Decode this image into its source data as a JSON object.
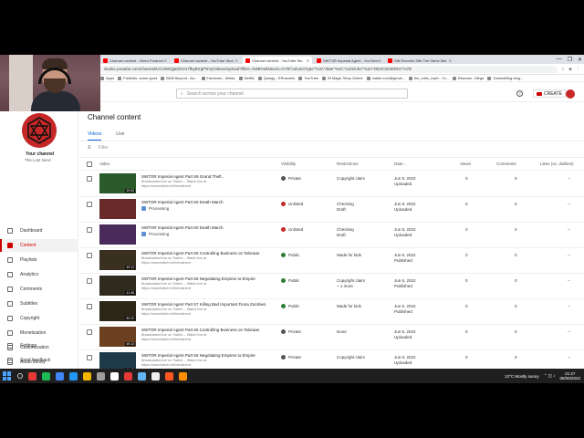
{
  "browser": {
    "tabs": [
      {
        "label": "Channel content - Video Producti",
        "color": "#ff0000"
      },
      {
        "label": "Channel content - YouTube Stud",
        "color": "#ff0000"
      },
      {
        "label": "Channel content - YouTube Stu",
        "color": "#ff0000",
        "active": true
      },
      {
        "label": "SWTOR Imperial Agent - YouTube",
        "color": "#ff0000"
      },
      {
        "label": "Still Recruits Sith The Stone Mol",
        "color": "#ff0000"
      }
    ],
    "url": "studio.youtube.com/channel/UCHiWQpDbOrs7fbyBrrgFNVy/videos/upload?filter=%5B%5D&sort=%7B\"columnType\"%3A\"date\"%2C\"sortOrder\"%3A\"DESCENDING\"%7D",
    "bookmarks": [
      "Apps",
      "Fanfictio. some good",
      "B&B Beyond - Ao...",
      "Fandoms - Weiss",
      "Netflix",
      "Quingy - ERnsomts",
      "YouTube",
      "Bl Magic Shop Online",
      "mailer.com@gmail...",
      "the_critic_myth - Yo...",
      "Bhumas - Mega",
      "GamesBlog blog..."
    ],
    "win_controls": [
      "—",
      "❐",
      "✕"
    ]
  },
  "header": {
    "search_placeholder": "Search across your channel",
    "help_glyph": "?",
    "create_label": "CREATE"
  },
  "sidebar": {
    "your_channel": "Your channel",
    "channel_name": "The Lost Nerd",
    "items": [
      {
        "label": "Dashboard",
        "icon": "dashboard-icon"
      },
      {
        "label": "Content",
        "icon": "content-icon",
        "active": true
      },
      {
        "label": "Playlists",
        "icon": "playlists-icon"
      },
      {
        "label": "Analytics",
        "icon": "analytics-icon"
      },
      {
        "label": "Comments",
        "icon": "comments-icon"
      },
      {
        "label": "Subtitles",
        "icon": "subtitles-icon"
      },
      {
        "label": "Copyright",
        "icon": "copyright-icon"
      },
      {
        "label": "Monetization",
        "icon": "monetization-icon"
      },
      {
        "label": "Customization",
        "icon": "customization-icon"
      },
      {
        "label": "Audio library",
        "icon": "audio-library-icon"
      }
    ],
    "bottom_items": [
      {
        "label": "Settings",
        "icon": "settings-icon"
      },
      {
        "label": "Send feedback",
        "icon": "feedback-icon"
      }
    ]
  },
  "main": {
    "title": "Channel content",
    "tabs": [
      "Videos",
      "Live"
    ],
    "filter_placeholder": "Filter",
    "columns": {
      "video": "Video",
      "visibility": "Visibility",
      "restrictions": "Restrictions",
      "date": "Date ↓",
      "views": "Views",
      "comments": "Comments",
      "likes": "Likes (vs. dislikes)"
    },
    "rows": [
      {
        "title": "SWTOR Imperial Agent Part 59 Grand Theft...",
        "desc": "Broadcasted live on Twitch -- Watch live at",
        "link": "https://www.twitch.tv/thelostnerd",
        "duration": "49:55",
        "thumb": "#2a5a2a",
        "visibility": "Private",
        "vis_color": "#555",
        "restriction": "Copyright claim",
        "restriction2": "",
        "date": "Jun 8, 2022",
        "date_status": "Uploaded",
        "views": "0",
        "comments": "0",
        "likes": "–",
        "processing": false
      },
      {
        "title": "SWTOR Imperial Agent Part 60 Death March",
        "desc": "",
        "link": "",
        "duration": "",
        "thumb": "#6a2a2a",
        "visibility": "Unlisted",
        "vis_color": "#c62828",
        "restriction": "Checking",
        "restriction2": "Draft",
        "date": "Jun 8, 2022",
        "date_status": "Uploaded",
        "views": "0",
        "comments": "0",
        "likes": "–",
        "processing": true,
        "processing_label": "Processing"
      },
      {
        "title": "SWTOR Imperial Agent Part 60 Death March",
        "desc": "",
        "link": "",
        "duration": "",
        "thumb": "#4a2a5a",
        "visibility": "Unlisted",
        "vis_color": "#c62828",
        "restriction": "Checking",
        "restriction2": "Draft",
        "date": "Jun 8, 2022",
        "date_status": "Uploaded",
        "views": "0",
        "comments": "0",
        "likes": "–",
        "processing": true,
        "processing_label": "Processing"
      },
      {
        "title": "SWTOR Imperial Agent Part 59 Controlling Business on Taloraan",
        "desc": "Broadcasted live on Twitch -- Watch live at",
        "link": "https://www.twitch.tv/thelostnerd",
        "duration": "49:13",
        "thumb": "#3a3020",
        "visibility": "Public",
        "vis_color": "#2e7d32",
        "restriction": "Made for kids",
        "restriction2": "",
        "date": "Jun 8, 2022",
        "date_status": "Published",
        "views": "0",
        "comments": "0",
        "likes": "–",
        "processing": false
      },
      {
        "title": "SWTOR Imperial Agent Part 58 Negotiating Empires to Empire",
        "desc": "Broadcasted live on Twitch -- Watch live at",
        "link": "https://www.twitch.tv/thelostnerd",
        "duration": "41:48",
        "thumb": "#2f2a1e",
        "visibility": "Public",
        "vis_color": "#2e7d32",
        "restriction": "Copyright claim",
        "restriction2": "+ 1 more",
        "date": "Jun 6, 2022",
        "date_status": "Published",
        "views": "0",
        "comments": "0",
        "likes": "–",
        "processing": false
      },
      {
        "title": "SWTOR Imperial Agent Part 57 Killing Bad Important Fiona Zombies",
        "desc": "Broadcasted live on Twitch -- Watch live at",
        "link": "https://www.twitch.tv/thelostnerd",
        "duration": "50:20",
        "thumb": "#2c2618",
        "visibility": "Public",
        "vis_color": "#2e7d32",
        "restriction": "Made for kids",
        "restriction2": "",
        "date": "Jun 6, 2022",
        "date_status": "Published",
        "views": "0",
        "comments": "0",
        "likes": "–",
        "processing": false
      },
      {
        "title": "SWTOR Imperial Agent Part 56 Controlling Business on Taloraan",
        "desc": "Broadcasted live on Twitch -- Watch live at",
        "link": "https://www.twitch.tv/thelostnerd",
        "duration": "49:13",
        "thumb": "#6a4020",
        "visibility": "Private",
        "vis_color": "#555",
        "restriction": "None",
        "restriction2": "",
        "date": "Jun 6, 2022",
        "date_status": "Uploaded",
        "views": "0",
        "comments": "0",
        "likes": "–",
        "processing": false
      },
      {
        "title": "SWTOR Imperial Agent Part 55 Negotiating Empires to Empire",
        "desc": "Broadcasted live on Twitch -- Watch live at",
        "link": "https://www.twitch.tv/thelostnerd",
        "duration": "41:48",
        "thumb": "#1e3a4a",
        "visibility": "Private",
        "vis_color": "#555",
        "restriction": "Copyright claim",
        "restriction2": "",
        "date": "Jun 6, 2022",
        "date_status": "Uploaded",
        "views": "0",
        "comments": "0",
        "likes": "–",
        "processing": false
      }
    ]
  },
  "taskbar": {
    "apps": [
      "#e53935",
      "#1db954",
      "#4285f4",
      "#2196f3",
      "#f4b400",
      "#9e9e9e",
      "#ffffff",
      "#e53935",
      "#64b5f6",
      "#eeeeee",
      "#ff5722",
      "#ff8f00"
    ],
    "weather": "13°C  Mostly sunny",
    "time": "21:27",
    "date": "06/06/2022"
  }
}
